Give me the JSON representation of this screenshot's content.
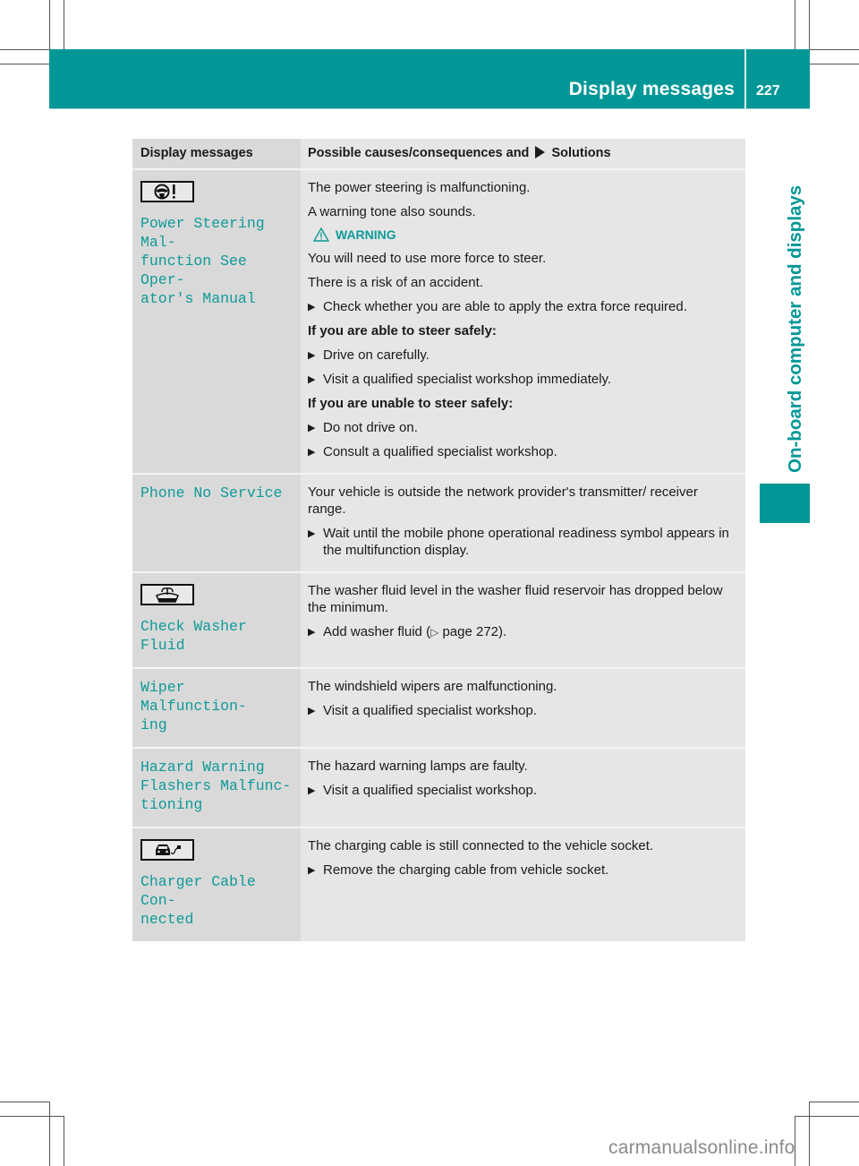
{
  "header": {
    "section_title": "Display messages",
    "page_number": "227"
  },
  "side_tab": {
    "chapter_label": "On-board computer and displays"
  },
  "table": {
    "col1_header": "Display messages",
    "col2_header_before": "Possible causes/consequences and",
    "col2_header_after": "Solutions",
    "rows": [
      {
        "icon": "power-steering-warning-icon",
        "message": "Power Steering Mal-\nfunction See Oper-\nator's Manual",
        "lines": {
          "l1": "The power steering is malfunctioning.",
          "l2": "A warning tone also sounds.",
          "warning": "WARNING",
          "l3": "You will need to use more force to steer.",
          "l4": "There is a risk of an accident.",
          "s1": "Check whether you are able to apply the extra force required.",
          "h1": "If you are able to steer safely:",
          "s2": "Drive on carefully.",
          "s3": "Visit a qualified specialist workshop immediately.",
          "h2": "If you are unable to steer safely:",
          "s4": "Do not drive on.",
          "s5": "Consult a qualified specialist workshop."
        }
      },
      {
        "message": "Phone No Service",
        "lines": {
          "l1": "Your vehicle is outside the network provider's transmitter/ receiver range.",
          "s1": "Wait until the mobile phone operational readiness symbol appears in the multifunction display."
        }
      },
      {
        "icon": "washer-fluid-icon",
        "message": "Check Washer Fluid",
        "lines": {
          "l1": "The washer fluid level in the washer fluid reservoir has dropped below the minimum.",
          "s1_before": "Add washer fluid (",
          "s1_ref": "▷",
          "s1_after": " page 272)."
        }
      },
      {
        "message": "Wiper Malfunction-\ning",
        "lines": {
          "l1": "The windshield wipers are malfunctioning.",
          "s1": "Visit a qualified specialist workshop."
        }
      },
      {
        "message": "Hazard Warning\nFlashers Malfunc-\ntioning",
        "lines": {
          "l1": "The hazard warning lamps are faulty.",
          "s1": "Visit a qualified specialist workshop."
        }
      },
      {
        "icon": "charger-cable-icon",
        "message": "Charger Cable Con-\nnected",
        "lines": {
          "l1": "The charging cable is still connected to the vehicle socket.",
          "s1": "Remove the charging cable from vehicle socket."
        }
      }
    ]
  },
  "step_arrow": "▶",
  "watermark": "carmanualsonline.info",
  "colors": {
    "accent_teal": "#009796",
    "cell_dark": "#d9d9d9",
    "cell_light": "#e6e6e6"
  }
}
